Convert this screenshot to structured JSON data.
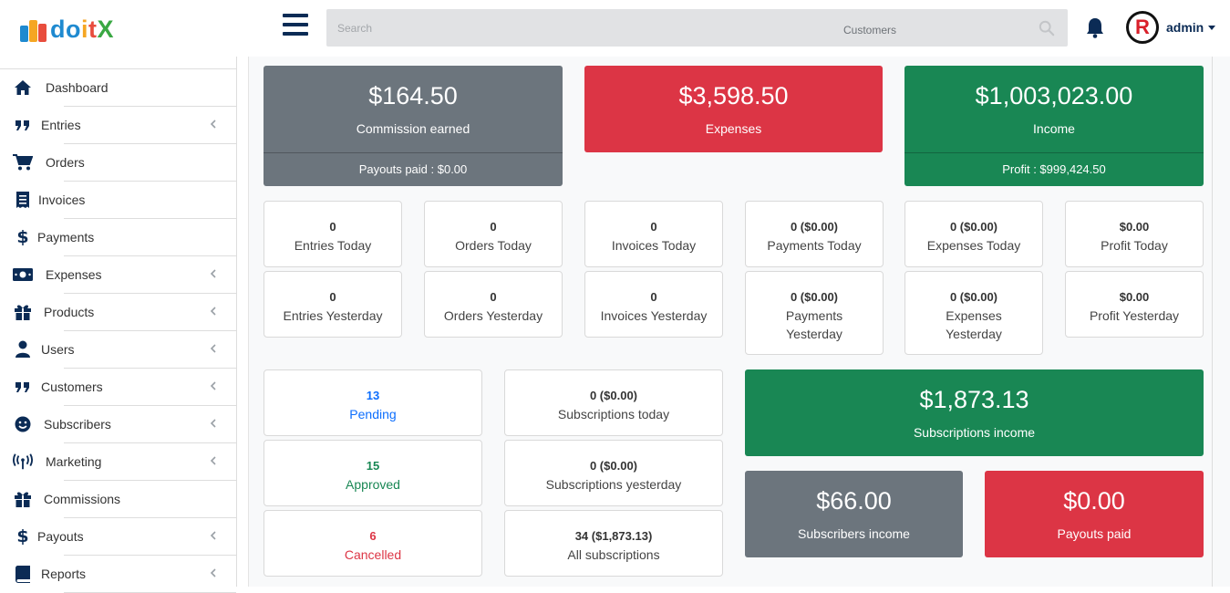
{
  "header": {
    "logo_text_1": "do",
    "logo_text_2": "i",
    "logo_text_3": "t",
    "logo_text_4": "X",
    "search_placeholder": "Search",
    "search_scope": "Customers",
    "user_name": "admin",
    "avatar_letter": "R"
  },
  "sidebar": {
    "items": [
      {
        "label": "Dashboard",
        "icon": "home-icon",
        "expandable": false
      },
      {
        "label": "Entries",
        "icon": "quote-icon",
        "expandable": true
      },
      {
        "label": "Orders",
        "icon": "cart-icon",
        "expandable": false
      },
      {
        "label": "Invoices",
        "icon": "receipt-icon",
        "expandable": false
      },
      {
        "label": "Payments",
        "icon": "dollar-icon",
        "expandable": false
      },
      {
        "label": "Expenses",
        "icon": "money-bill-icon",
        "expandable": true
      },
      {
        "label": "Products",
        "icon": "gift-icon",
        "expandable": true
      },
      {
        "label": "Users",
        "icon": "user-icon",
        "expandable": true
      },
      {
        "label": "Customers",
        "icon": "quote-icon",
        "expandable": true
      },
      {
        "label": "Subscribers",
        "icon": "smile-icon",
        "expandable": true
      },
      {
        "label": "Marketing",
        "icon": "broadcast-icon",
        "expandable": true
      },
      {
        "label": "Commissions",
        "icon": "gift-icon",
        "expandable": false
      },
      {
        "label": "Payouts",
        "icon": "dollar-icon",
        "expandable": true
      },
      {
        "label": "Reports",
        "icon": "book-icon",
        "expandable": true
      }
    ]
  },
  "summary": {
    "commission": {
      "amount": "$164.50",
      "caption": "Commission earned",
      "footer": "Payouts paid : $0.00"
    },
    "expenses": {
      "amount": "$3,598.50",
      "caption": "Expenses"
    },
    "income": {
      "amount": "$1,003,023.00",
      "caption": "Income",
      "footer": "Profit : $999,424.50"
    }
  },
  "today": [
    {
      "value": "0",
      "label": "Entries Today"
    },
    {
      "value": "0",
      "label": "Orders Today"
    },
    {
      "value": "0",
      "label": "Invoices Today"
    },
    {
      "value": "0 ($0.00)",
      "label": "Payments Today"
    },
    {
      "value": "0 ($0.00)",
      "label": "Expenses Today"
    },
    {
      "value": "$0.00",
      "label": "Profit Today"
    }
  ],
  "yesterday": [
    {
      "value": "0",
      "label": "Entries Yesterday"
    },
    {
      "value": "0",
      "label": "Orders Yesterday"
    },
    {
      "value": "0",
      "label": "Invoices Yesterday"
    },
    {
      "value": "0 ($0.00)",
      "label": "Payments",
      "label2": "Yesterday"
    },
    {
      "value": "0 ($0.00)",
      "label": "Expenses",
      "label2": "Yesterday"
    },
    {
      "value": "$0.00",
      "label": "Profit Yesterday"
    }
  ],
  "status": [
    {
      "value": "13",
      "label": "Pending",
      "color": "#0d6efd"
    },
    {
      "value": "15",
      "label": "Approved",
      "color": "#198754"
    },
    {
      "value": "6",
      "label": "Cancelled",
      "color": "#dc3545"
    }
  ],
  "subscriptions": [
    {
      "value": "0 ($0.00)",
      "label": "Subscriptions today"
    },
    {
      "value": "0 ($0.00)",
      "label": "Subscriptions yesterday"
    },
    {
      "value": "34 ($1,873.13)",
      "label": "All subscriptions"
    }
  ],
  "sub_income": {
    "amount": "$1,873.13",
    "caption": "Subscriptions income"
  },
  "subscribers_income": {
    "amount": "$66.00",
    "caption": "Subscribers income"
  },
  "payouts_paid": {
    "amount": "$0.00",
    "caption": "Payouts paid"
  },
  "colors": {
    "navy": "#0b2b55",
    "gray": "#6c757d",
    "red": "#dc3545",
    "green": "#198754",
    "blue": "#0d6efd"
  }
}
